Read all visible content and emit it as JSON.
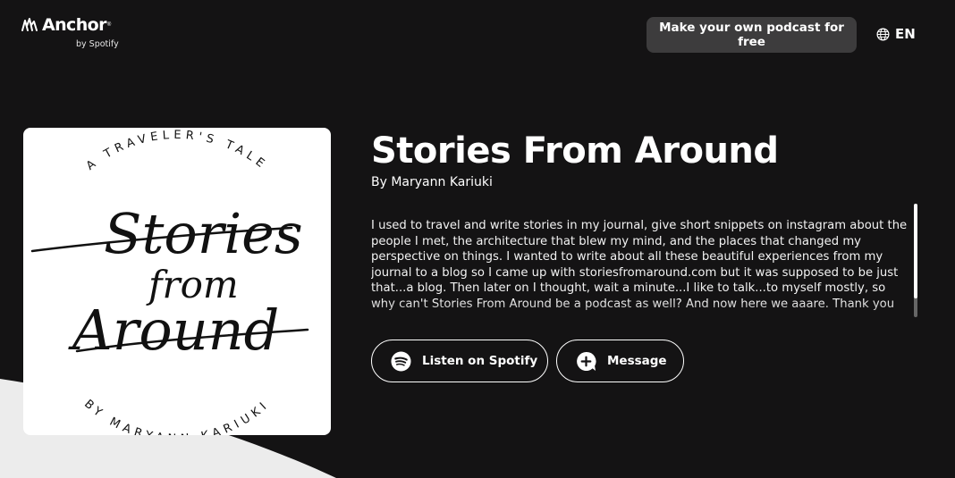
{
  "header": {
    "logo_text": "Anchor",
    "logo_subtext": "by Spotify",
    "cta_label": "Make your own podcast for free",
    "language": "EN"
  },
  "podcast": {
    "title": "Stories From Around",
    "author": "By Maryann Kariuki",
    "description": "I used to travel and write stories in my journal, give short snippets on instagram about the people I met, the architecture that blew my mind, and the places that changed my perspective on things. I wanted to write about all these beautiful experiences from my journal to a blog so I came up with storiesfromaround.com but it was supposed to be just that...a blog. Then later on I thought, wait a minute...I like to talk...to myself mostly, so why can't Stories From Around be a podcast as well? And now here we aaare. Thank you and welcome!"
  },
  "cover": {
    "top_text": "A TRAVELER'S TALE",
    "script_line_1": "Stories",
    "script_line_2": "from",
    "script_line_3": "Around",
    "bottom_text": "BY MARYANN KARIUKI"
  },
  "actions": {
    "spotify_label": "Listen on Spotify",
    "message_label": "Message"
  },
  "colors": {
    "background": "#141314",
    "cta_background": "#3d3c3d",
    "wedge": "#ececec"
  },
  "icons": {
    "logo": "anchor-logo-icon",
    "language": "globe-icon",
    "spotify": "spotify-icon",
    "message": "message-plus-icon"
  }
}
